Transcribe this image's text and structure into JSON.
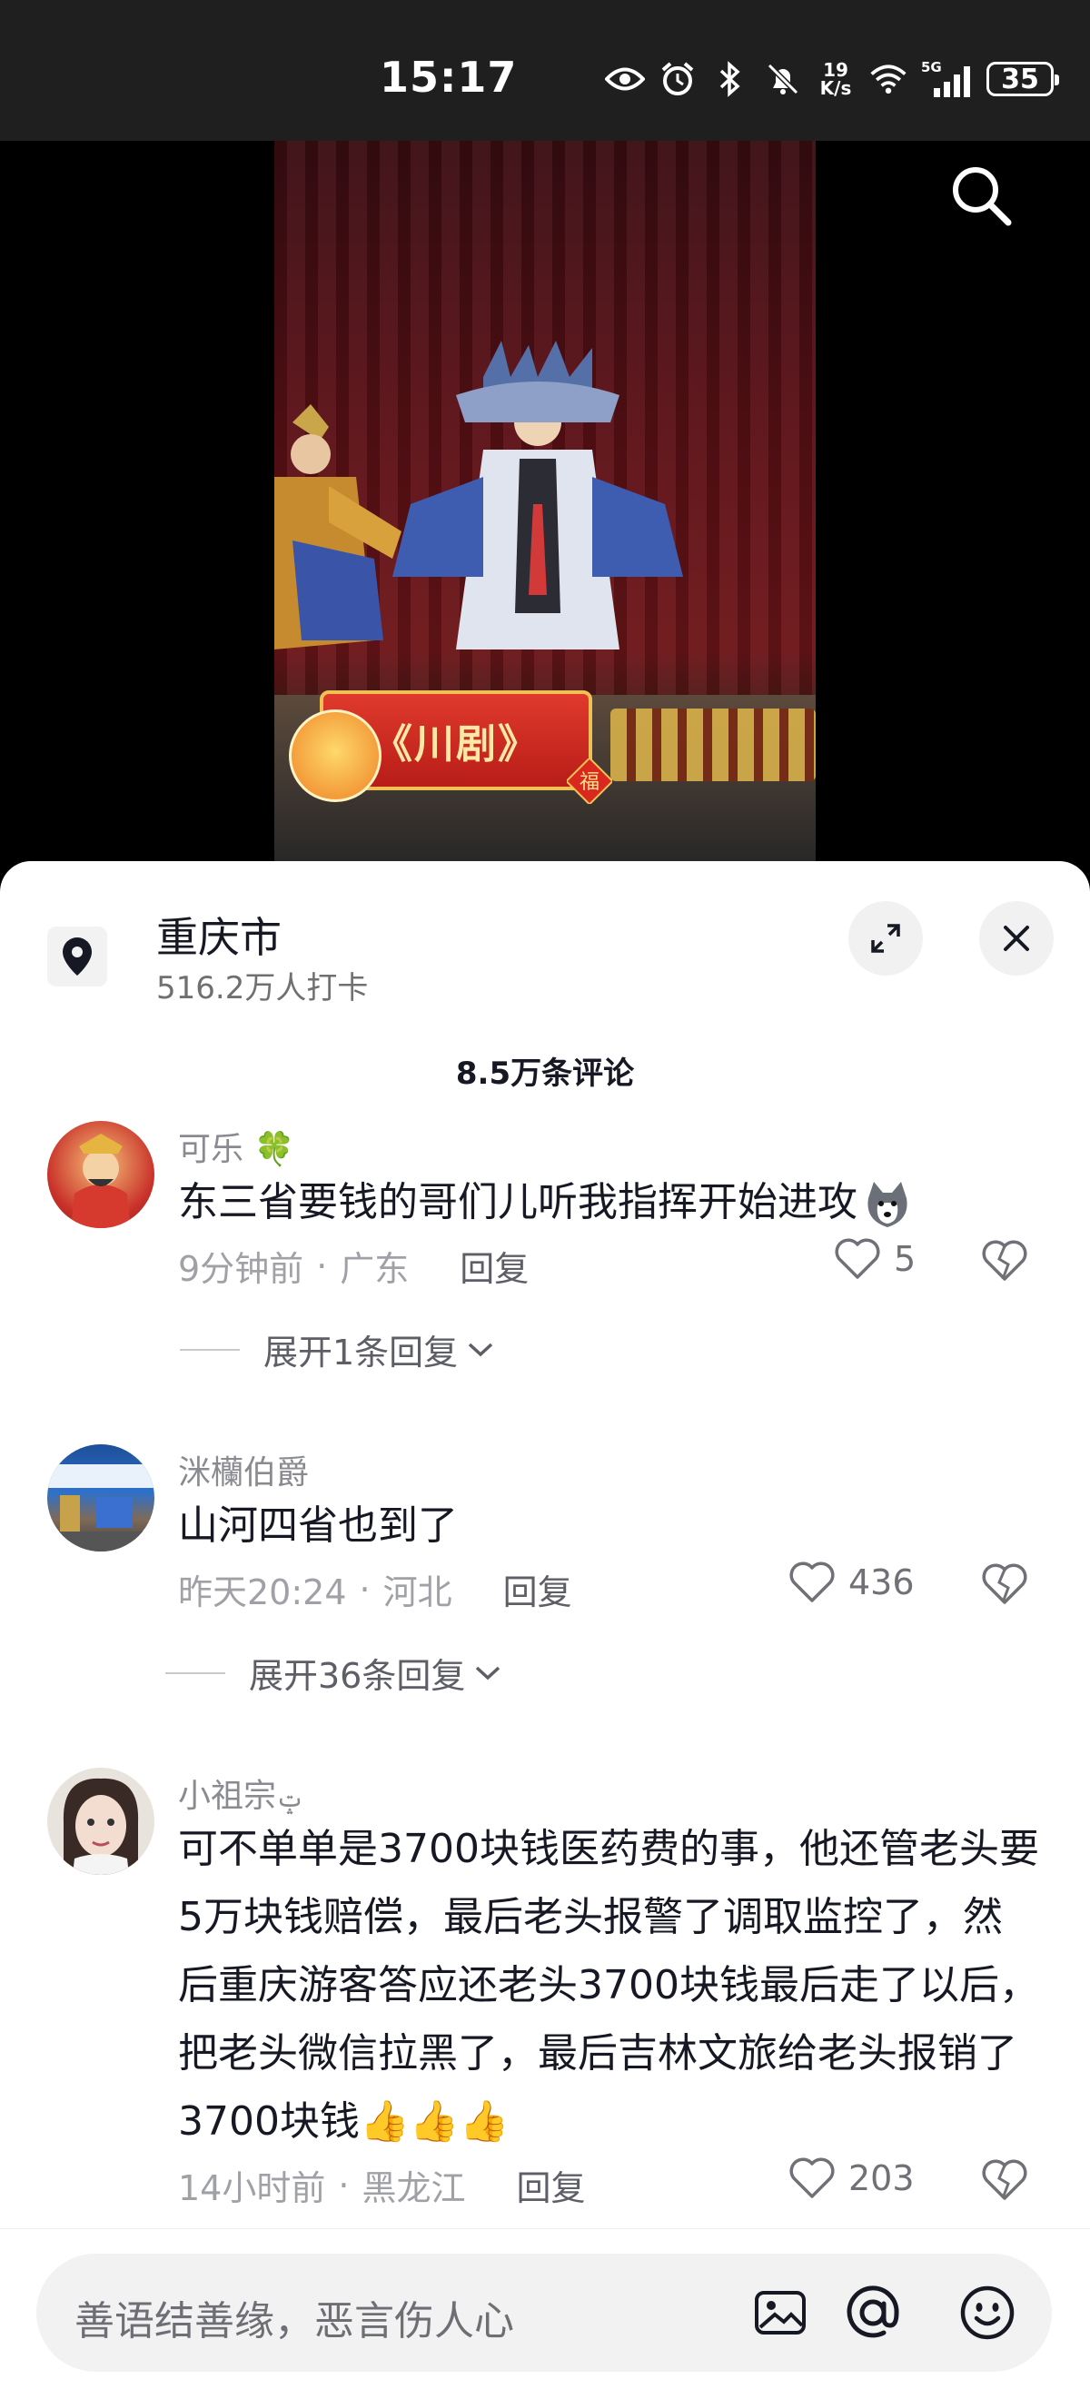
{
  "status_bar": {
    "time": "15:17",
    "net_speed_value": "19",
    "net_speed_unit": "K/s",
    "network": "5G",
    "battery": "35"
  },
  "video": {
    "banner_text": "《川剧》",
    "fu_char": "福"
  },
  "location": {
    "name": "重庆市",
    "checkins": "516.2万人打卡"
  },
  "comments_header": "8.5万条评论",
  "comments": [
    {
      "username": "可乐",
      "text": "东三省要钱的哥们儿听我指挥开始进攻",
      "time": "9分钟前",
      "region": "广东",
      "reply_label": "回复",
      "likes": "5",
      "expand": "展开1条回复"
    },
    {
      "username": "洣欗伯爵",
      "text": "山河四省也到了",
      "time": "昨天20:24",
      "region": "河北",
      "reply_label": "回复",
      "likes": "436",
      "expand": "展开36条回复"
    },
    {
      "username": "小祖宗",
      "text": "可不单单是3700块钱医药费的事，他还管老头要5万块钱赔偿，最后老头报警了调取监控了，然后重庆游客答应还老头3700块钱最后走了以后，把老头微信拉黑了，最后吉林文旅给老头报销了3700块钱👍👍👍",
      "time": "14小时前",
      "region": "黑龙江",
      "reply_label": "回复",
      "likes": "203"
    }
  ],
  "input": {
    "placeholder": "善语结善缘，恶言伤人心"
  },
  "colors": {
    "sheet_bg": "#ffffff",
    "text_primary": "#161823",
    "text_secondary": "#8a8b91",
    "video_bg": "#000000"
  }
}
